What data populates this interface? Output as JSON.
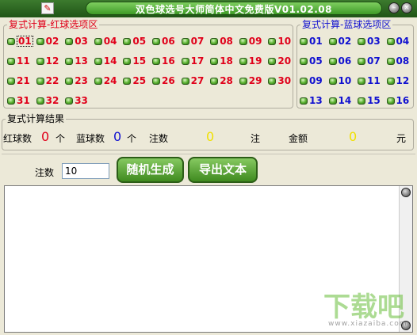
{
  "window": {
    "title": "双色球选号大师简体中文免费版V01.02.08",
    "colors": {
      "titlebar": "#2d6a22",
      "red_ball": "#e0001a",
      "blue_ball": "#1010d0",
      "yellow_value": "#f0e000"
    }
  },
  "red_panel": {
    "title": "复式计算-红球选项区",
    "balls": [
      "01",
      "02",
      "03",
      "04",
      "05",
      "06",
      "07",
      "08",
      "09",
      "10",
      "11",
      "12",
      "13",
      "14",
      "15",
      "16",
      "17",
      "18",
      "19",
      "20",
      "21",
      "22",
      "23",
      "24",
      "25",
      "26",
      "27",
      "28",
      "29",
      "30",
      "31",
      "32",
      "33"
    ],
    "selected": "01"
  },
  "blue_panel": {
    "title": "复式计算-蓝球选项区",
    "balls": [
      "01",
      "02",
      "03",
      "04",
      "05",
      "06",
      "07",
      "08",
      "09",
      "10",
      "11",
      "12",
      "13",
      "14",
      "15",
      "16"
    ]
  },
  "result": {
    "title": "复式计算结果",
    "red_count_label": "红球数",
    "red_count": "0",
    "unit_ge1": "个",
    "blue_count_label": "蓝球数",
    "blue_count": "0",
    "unit_ge2": "个",
    "bets_label": "注数",
    "bets_value": "0",
    "unit_zhu": "注",
    "amount_label": "金额",
    "amount_value": "0",
    "unit_yuan": "元"
  },
  "generator": {
    "count_label": "注数",
    "count_value": "10",
    "random_button": "随机生成",
    "export_button": "导出文本"
  },
  "watermark": {
    "main": "下载吧",
    "sub": "www.xiazaiba.com"
  }
}
